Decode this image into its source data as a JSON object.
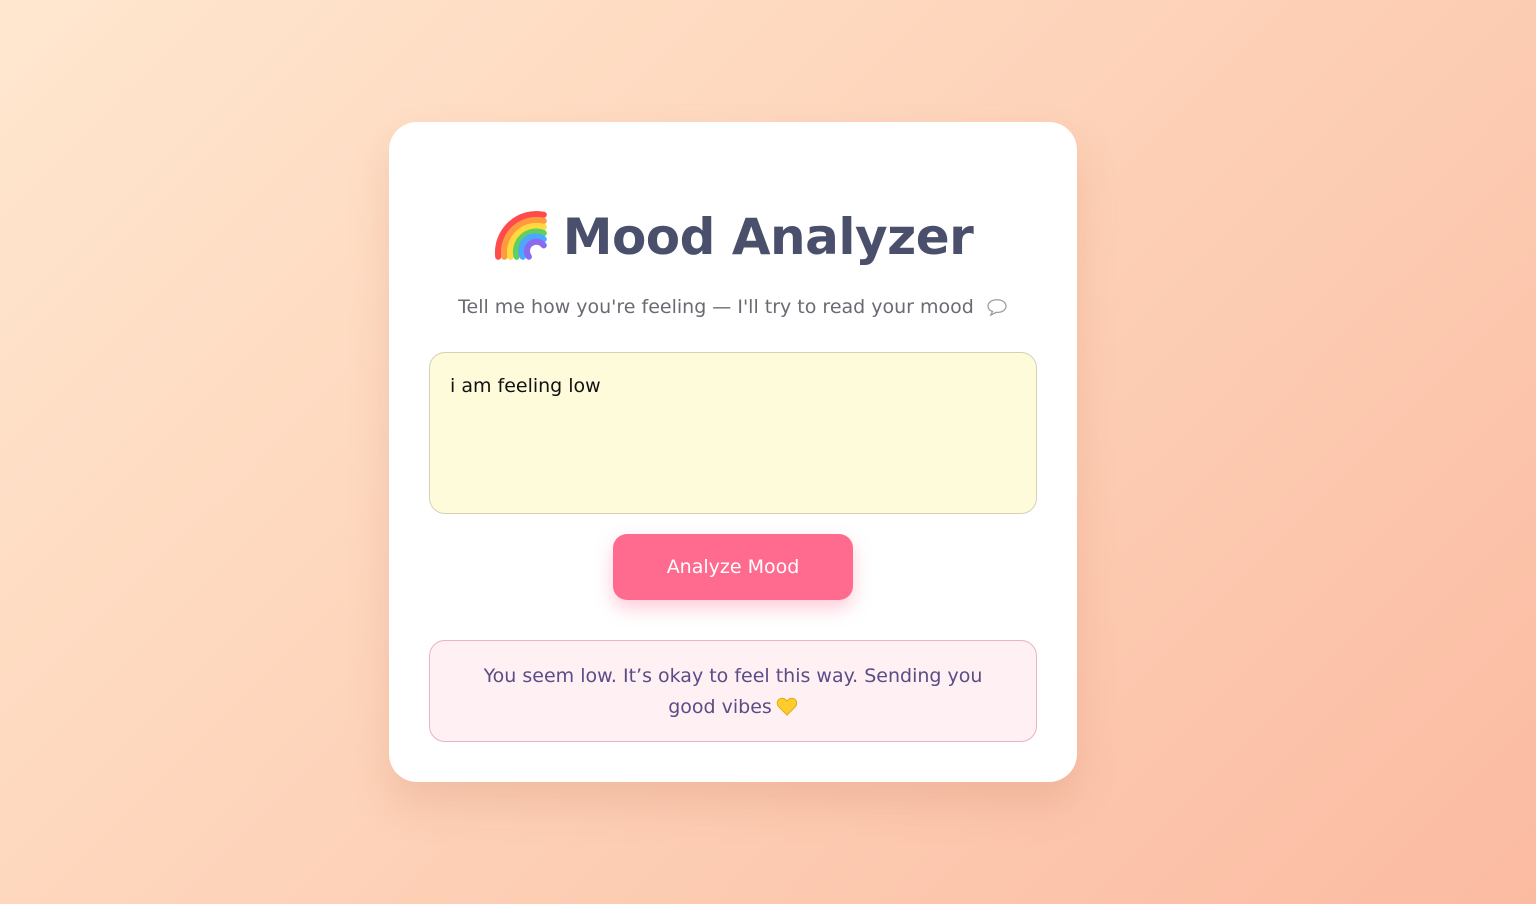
{
  "app": {
    "title": "Mood Analyzer",
    "title_icon": "rainbow-icon",
    "subtitle": "Tell me how you're feeling — I'll try to read your mood",
    "subtitle_icon": "speech-bubble-icon"
  },
  "input": {
    "value": "i am feeling low",
    "placeholder": ""
  },
  "actions": {
    "analyze_label": "Analyze Mood"
  },
  "result": {
    "message": "You seem low. It’s okay to feel this way. Sending you good vibes",
    "icon": "yellow-heart-icon"
  },
  "colors": {
    "accent": "#ff6b8f",
    "title_text": "#4a4f6b",
    "input_bg": "#fefbdb",
    "result_bg": "#fff0f4",
    "result_text": "#5b4c86"
  }
}
